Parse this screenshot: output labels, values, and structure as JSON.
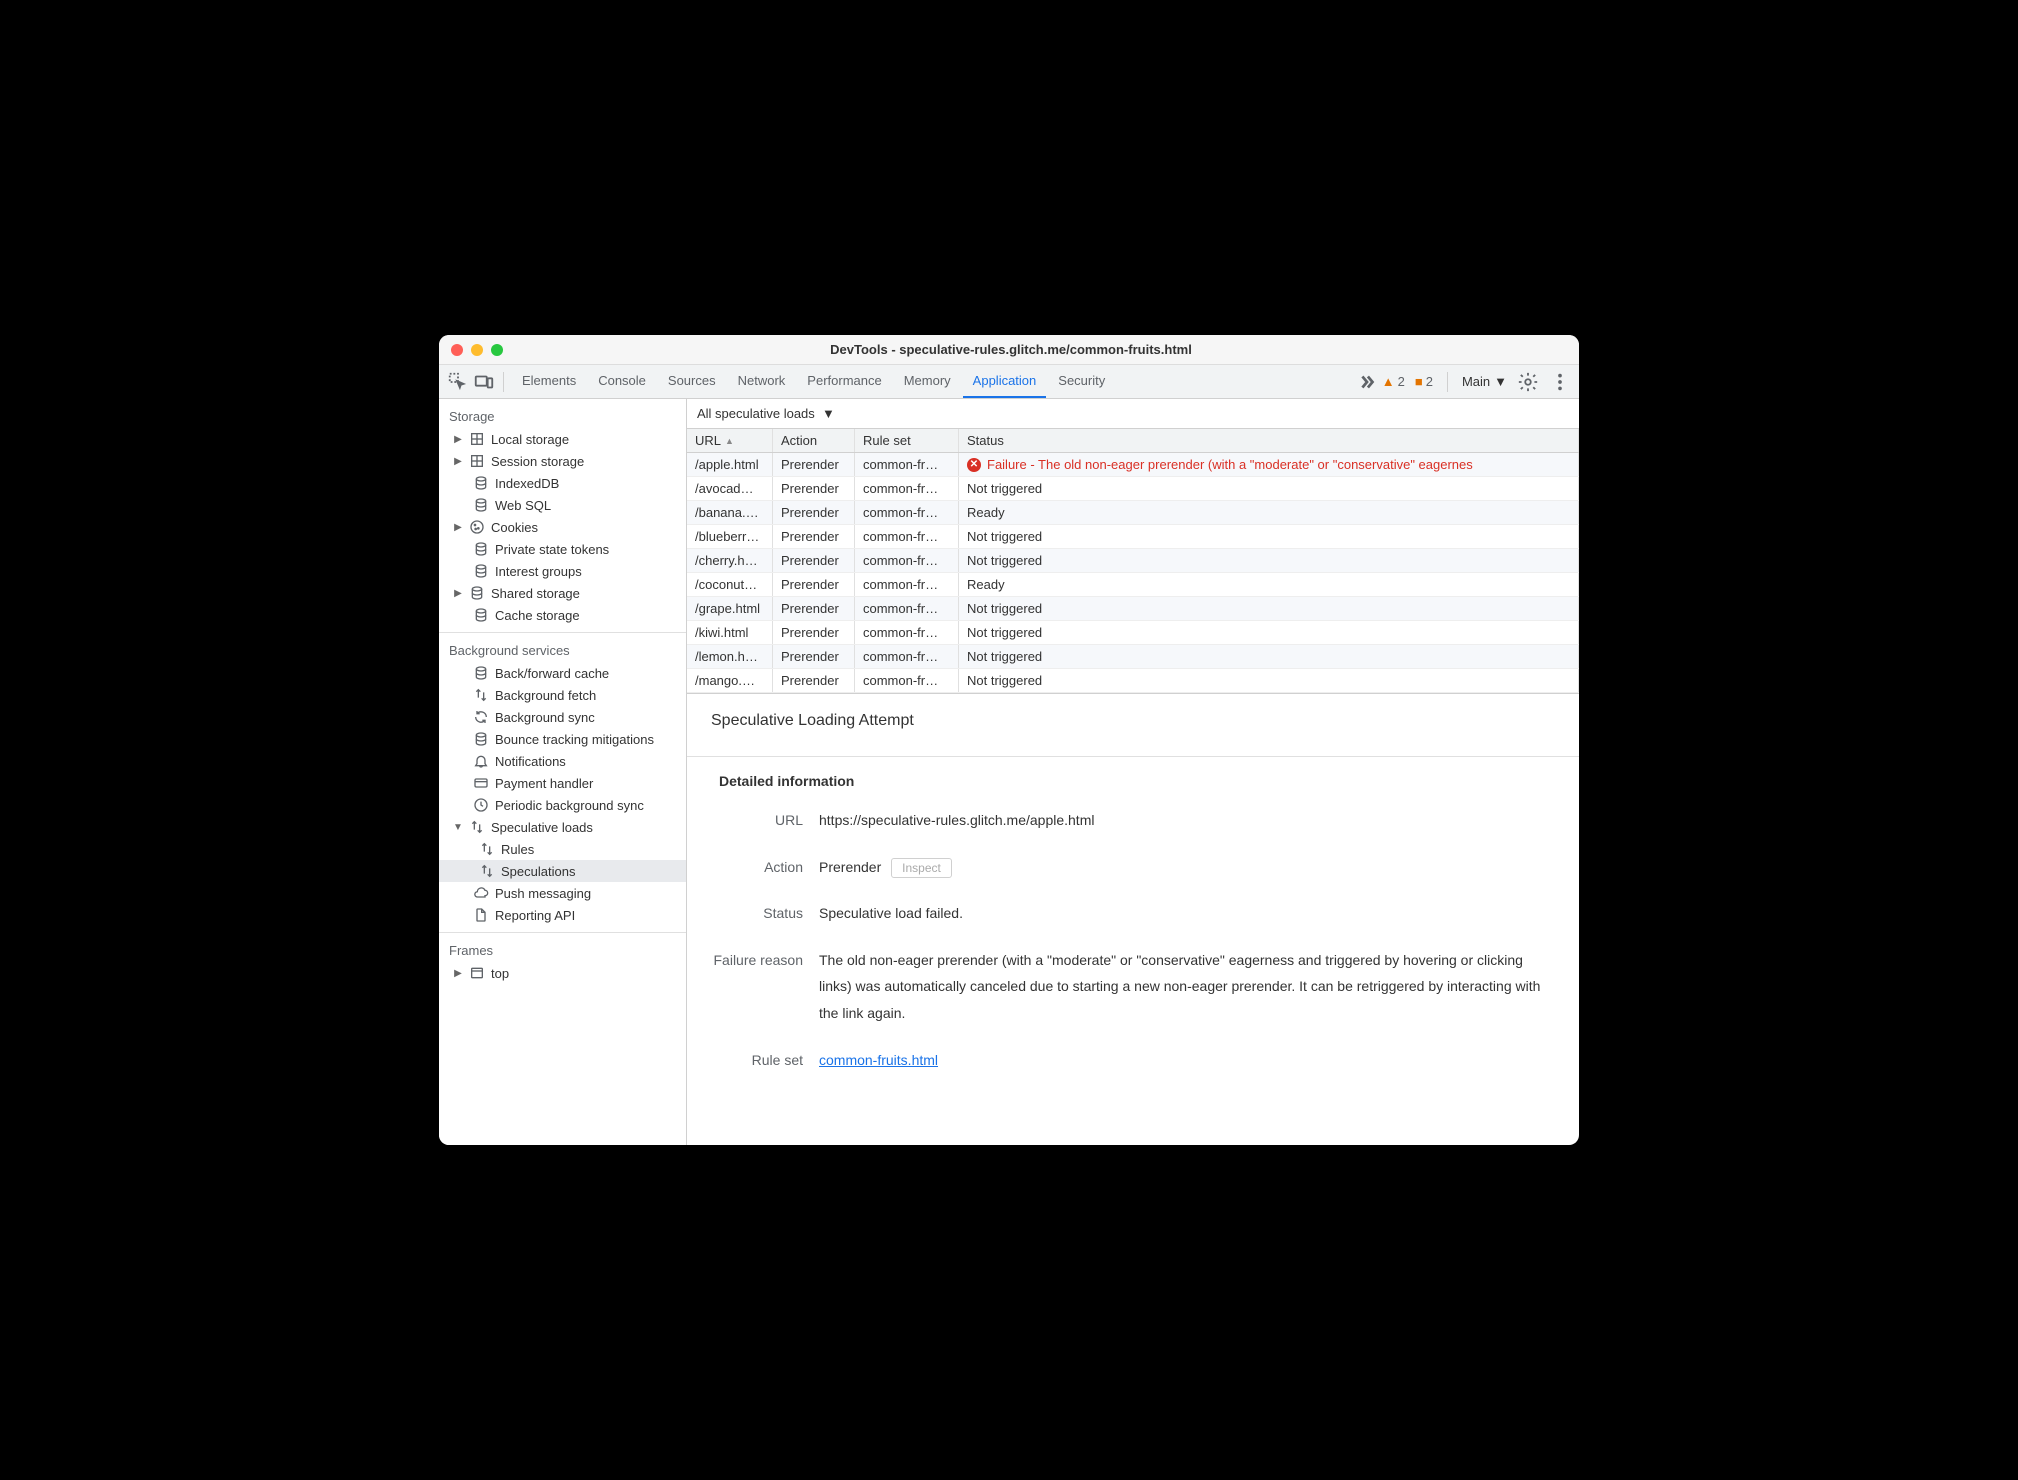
{
  "window_title": "DevTools - speculative-rules.glitch.me/common-fruits.html",
  "toolbar_tabs": [
    "Elements",
    "Console",
    "Sources",
    "Network",
    "Performance",
    "Memory",
    "Application",
    "Security"
  ],
  "active_tab": "Application",
  "warnings": {
    "triangle_count": "2",
    "square_count": "2"
  },
  "main_label": "Main",
  "sidebar": {
    "storage_header": "Storage",
    "storage_items": [
      {
        "label": "Local storage",
        "icon": "grid",
        "expandable": true
      },
      {
        "label": "Session storage",
        "icon": "grid",
        "expandable": true
      },
      {
        "label": "IndexedDB",
        "icon": "db",
        "expandable": false,
        "indent": true
      },
      {
        "label": "Web SQL",
        "icon": "db",
        "expandable": false,
        "indent": true
      },
      {
        "label": "Cookies",
        "icon": "cookie",
        "expandable": true
      },
      {
        "label": "Private state tokens",
        "icon": "db",
        "expandable": false,
        "indent": true
      },
      {
        "label": "Interest groups",
        "icon": "db",
        "expandable": false,
        "indent": true
      },
      {
        "label": "Shared storage",
        "icon": "db",
        "expandable": true
      },
      {
        "label": "Cache storage",
        "icon": "db",
        "expandable": false,
        "indent": true
      }
    ],
    "bg_header": "Background services",
    "bg_items": [
      {
        "label": "Back/forward cache",
        "icon": "db"
      },
      {
        "label": "Background fetch",
        "icon": "updown"
      },
      {
        "label": "Background sync",
        "icon": "sync"
      },
      {
        "label": "Bounce tracking mitigations",
        "icon": "db"
      },
      {
        "label": "Notifications",
        "icon": "bell"
      },
      {
        "label": "Payment handler",
        "icon": "card"
      },
      {
        "label": "Periodic background sync",
        "icon": "clock"
      },
      {
        "label": "Speculative loads",
        "icon": "updown",
        "expanded": true,
        "children": [
          {
            "label": "Rules",
            "icon": "updown"
          },
          {
            "label": "Speculations",
            "icon": "updown",
            "selected": true
          }
        ]
      },
      {
        "label": "Push messaging",
        "icon": "cloud"
      },
      {
        "label": "Reporting API",
        "icon": "file"
      }
    ],
    "frames_header": "Frames",
    "frames_items": [
      {
        "label": "top",
        "icon": "window",
        "expandable": true
      }
    ]
  },
  "filter_label": "All speculative loads",
  "table": {
    "headers": {
      "url": "URL",
      "action": "Action",
      "ruleset": "Rule set",
      "status": "Status"
    },
    "rows": [
      {
        "url": "/apple.html",
        "action": "Prerender",
        "ruleset": "common-fr…",
        "status": "Failure - The old non-eager prerender (with a \"moderate\" or \"conservative\" eagernes",
        "error": true
      },
      {
        "url": "/avocad…",
        "action": "Prerender",
        "ruleset": "common-fr…",
        "status": "Not triggered"
      },
      {
        "url": "/banana.…",
        "action": "Prerender",
        "ruleset": "common-fr…",
        "status": "Ready"
      },
      {
        "url": "/blueberr…",
        "action": "Prerender",
        "ruleset": "common-fr…",
        "status": "Not triggered"
      },
      {
        "url": "/cherry.h…",
        "action": "Prerender",
        "ruleset": "common-fr…",
        "status": "Not triggered"
      },
      {
        "url": "/coconut…",
        "action": "Prerender",
        "ruleset": "common-fr…",
        "status": "Ready"
      },
      {
        "url": "/grape.html",
        "action": "Prerender",
        "ruleset": "common-fr…",
        "status": "Not triggered"
      },
      {
        "url": "/kiwi.html",
        "action": "Prerender",
        "ruleset": "common-fr…",
        "status": "Not triggered"
      },
      {
        "url": "/lemon.h…",
        "action": "Prerender",
        "ruleset": "common-fr…",
        "status": "Not triggered"
      },
      {
        "url": "/mango.…",
        "action": "Prerender",
        "ruleset": "common-fr…",
        "status": "Not triggered"
      }
    ]
  },
  "detail": {
    "title": "Speculative Loading Attempt",
    "section_header": "Detailed information",
    "url_label": "URL",
    "url_value": "https://speculative-rules.glitch.me/apple.html",
    "action_label": "Action",
    "action_value": "Prerender",
    "inspect_label": "Inspect",
    "status_label": "Status",
    "status_value": "Speculative load failed.",
    "failure_label": "Failure reason",
    "failure_value": "The old non-eager prerender (with a \"moderate\" or \"conservative\" eagerness and triggered by hovering or clicking links) was automatically canceled due to starting a new non-eager prerender. It can be retriggered by interacting with the link again.",
    "ruleset_label": "Rule set",
    "ruleset_value": "common-fruits.html"
  }
}
